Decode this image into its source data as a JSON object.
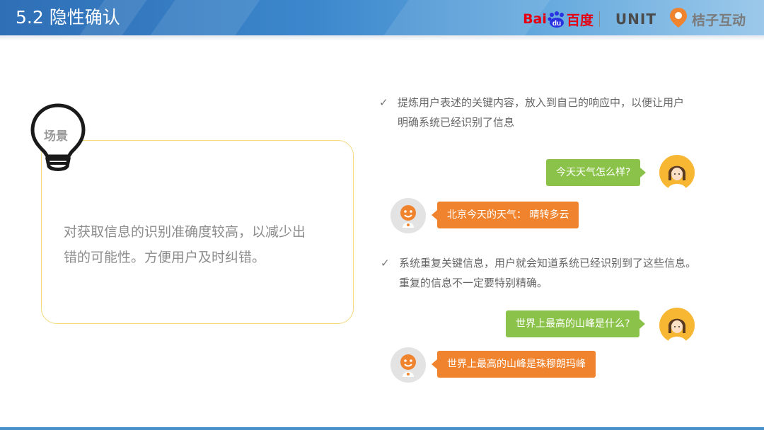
{
  "header": {
    "title": "5.2 隐性确认",
    "logo_baidu_left": "Bai",
    "logo_baidu_du": "du",
    "logo_baidu_right": "百度",
    "logo_unit": "UNIT",
    "logo_juzi": "桔子互动"
  },
  "scene": {
    "label": "场景",
    "text": "对获取信息的识别准确度较高，以减少出错的可能性。方便用户及时纠错。"
  },
  "bullets": [
    {
      "check": "✓",
      "text_line1": "提炼用户表述的关键内容，放入到自己的响应中，以便让用户",
      "text_line2": "明确系统已经识别了信息"
    },
    {
      "check": "✓",
      "text_line1": "系统重复关键信息，用户就会知道系统已经识别到了这些信息。",
      "text_line2": "重复的信息不一定要特别精确。"
    }
  ],
  "chat": [
    {
      "user": "今天天气怎么样?",
      "bot": "北京今天的天气： 晴转多云"
    },
    {
      "user": "世界上最高的山峰是什么?",
      "bot": "世界上最高的山峰是珠穆朗玛峰"
    }
  ],
  "colors": {
    "header_blue": "#2f6fb6",
    "user_bubble": "#8bc34a",
    "bot_bubble": "#f0832e",
    "card_border": "#f1d97c"
  }
}
